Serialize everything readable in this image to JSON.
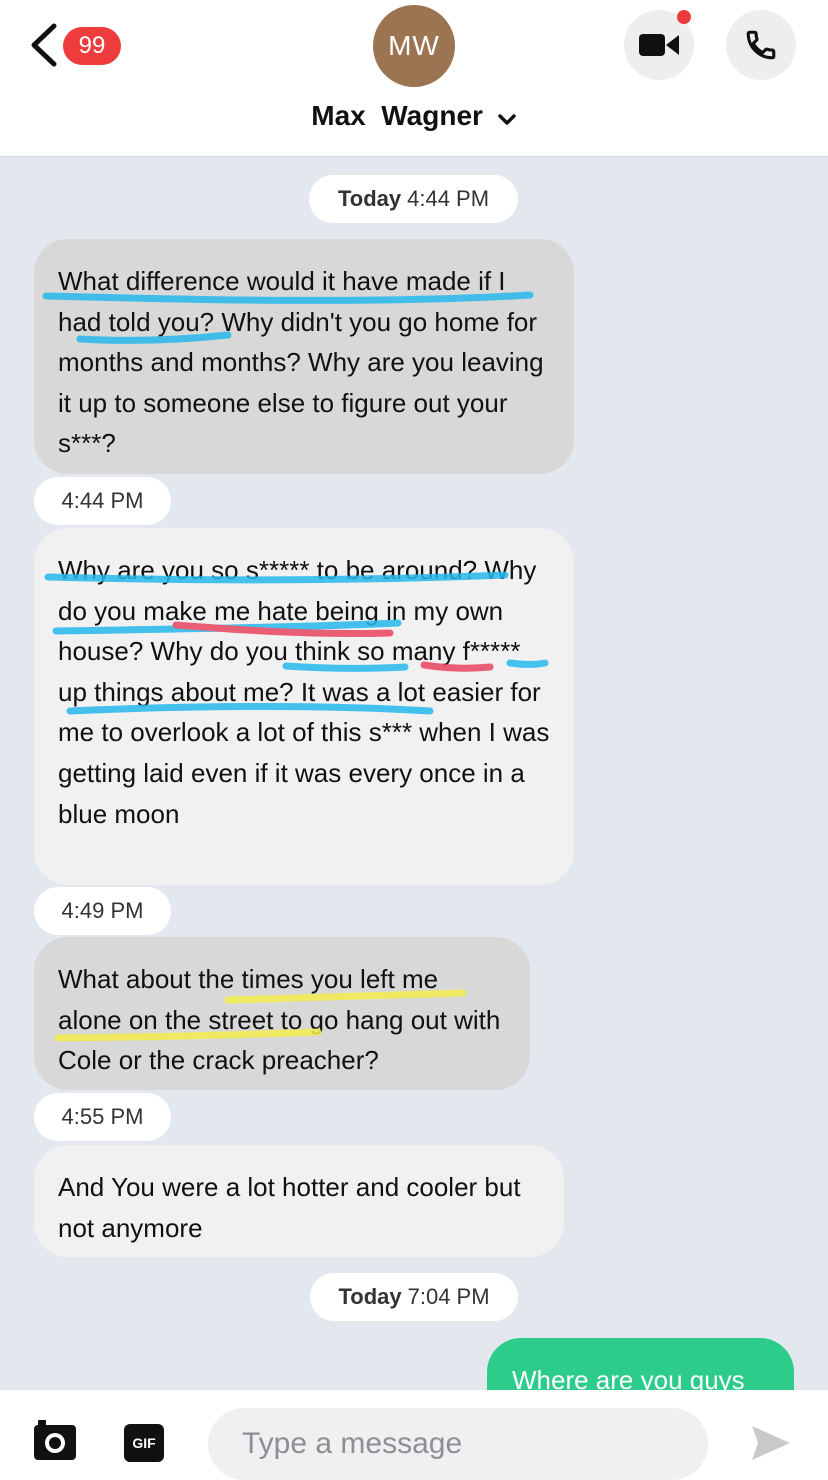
{
  "header": {
    "back_label": "Back",
    "unread_count": "99",
    "avatar_initials": "MW",
    "contact_name": "Max  Wagner"
  },
  "colors": {
    "badge": "#ee3b3b",
    "avatar": "#9b7452",
    "outgoing_bubble": "#2dcc8b",
    "highlight_blue": "#27b8ec",
    "highlight_red": "#e84560",
    "highlight_yellow": "#f5ec4e"
  },
  "thread": [
    {
      "type": "timestamp",
      "day": "Today",
      "time": "4:44 PM"
    },
    {
      "type": "incoming",
      "text": "What difference would it have made if I had told you? Why didn't you go home for months and months? Why are you leaving it up to someone else to figure out your s***?"
    },
    {
      "type": "timestamp",
      "day": "",
      "time": "4:44 PM"
    },
    {
      "type": "incoming",
      "text": "Why are you so s***** to be around? Why do you make me hate being in my own house? Why do you think so many f***** up things about me? It was a lot easier for me to overlook a lot of this s*** when I was getting laid even if it was every once in a blue moon"
    },
    {
      "type": "timestamp",
      "day": "",
      "time": "4:49 PM"
    },
    {
      "type": "incoming",
      "text": "What about the times you left me alone on the street to go hang out with Cole or the crack preacher?"
    },
    {
      "type": "timestamp",
      "day": "",
      "time": "4:55 PM"
    },
    {
      "type": "incoming",
      "text": "And You were a lot hotter and cooler but not anymore"
    },
    {
      "type": "timestamp",
      "day": "Today",
      "time": "7:04 PM"
    },
    {
      "type": "outgoing",
      "text": "Where are you guys"
    }
  ],
  "composer": {
    "placeholder": "Type a message",
    "gif_label": "GIF"
  },
  "icons": {
    "back": "chevron-left-icon",
    "video": "video-camera-icon",
    "call": "phone-icon",
    "camera": "camera-icon",
    "send": "send-arrow-icon"
  }
}
